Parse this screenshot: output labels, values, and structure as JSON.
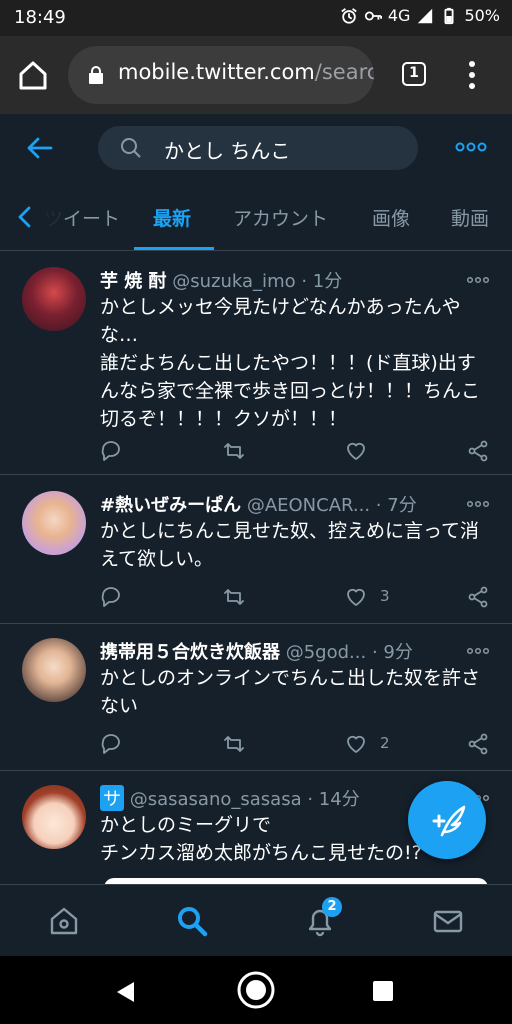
{
  "status_bar": {
    "time": "18:49",
    "network": "4G",
    "battery": "50%"
  },
  "browser": {
    "url_host": "mobile.twitter.com",
    "url_path": "/search",
    "tab_count": "1"
  },
  "search": {
    "query": "かとし ちんこ"
  },
  "tabs": [
    "ツイート",
    "最新",
    "アカウント",
    "画像",
    "動画"
  ],
  "active_tab": "最新",
  "tweets": [
    {
      "name": "芋 焼 酎",
      "handle": "@suzuka_imo",
      "time": "· 1分",
      "text": "かとしメッセ今見たけどなんかあったんやな…\n誰だよちんこ出したやつ！！！(ド直球)出すんなら家で全裸で歩き回っとけ！！！ちんこ切るぞ！！！！クソが！！！",
      "likes": ""
    },
    {
      "name": "#熱いぜみーぱん",
      "handle": "@AEONCAR...",
      "time": "· 7分",
      "text": "かとしにちんこ見せた奴、控えめに言って消えて欲しい。",
      "likes": "3"
    },
    {
      "name": "携帯用５合炊き炊飯器",
      "handle": "@5god...",
      "time": "· 9分",
      "text": "かとしのオンラインでちんこ出した奴を許さない",
      "likes": "2"
    },
    {
      "name": "サ",
      "handle": "@sasasano_sasasa",
      "time": "· 14分",
      "text": "かとしのミーグリで\nチンカス溜め太郎がちんこ見せたの!?",
      "likes": ""
    }
  ],
  "notifications_badge": "2",
  "colors": {
    "background": "#15202b",
    "accent": "#1da1f2",
    "secondary_text": "#8899a6",
    "divider": "#38444d"
  }
}
